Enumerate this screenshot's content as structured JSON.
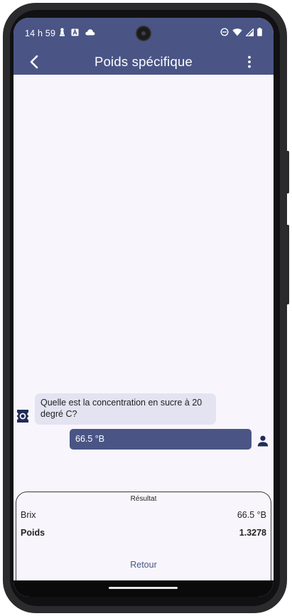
{
  "status_bar": {
    "time": "14 h 59",
    "left_icons": [
      "chess-piece-icon",
      "a-box-icon",
      "cloud-icon"
    ],
    "right_icons": [
      "do-not-disturb-icon",
      "wifi-icon",
      "signal-icon",
      "battery-icon"
    ]
  },
  "app_bar": {
    "title": "Poids spécifique",
    "back_icon": "arrow-left-icon",
    "menu_icon": "more-vert-icon"
  },
  "chat": {
    "bot_message": "Quelle est la concentration en sucre à 20 degré C?",
    "user_message": "66.5 °B"
  },
  "result": {
    "title": "Résultat",
    "rows": [
      {
        "label": "Brix",
        "value": "66.5 °B"
      },
      {
        "label": "Poids",
        "value": "1.3278"
      }
    ],
    "button": "Retour"
  },
  "colors": {
    "primary": "#4a5585",
    "background": "#f8f6fc",
    "bot_bubble": "#e3e3f1"
  }
}
